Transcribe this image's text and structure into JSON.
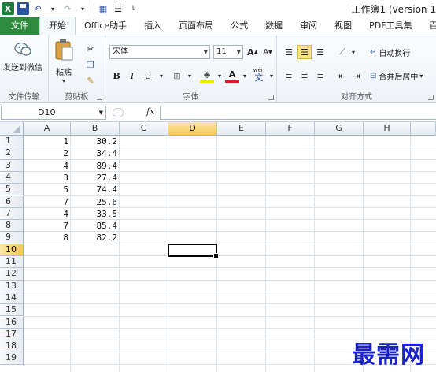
{
  "titlebar": {
    "title": "工作簿1 (version 1",
    "quick_access": [
      "excel-logo",
      "save-icon",
      "undo-icon",
      "redo-icon",
      "form-icon",
      "menu-icon"
    ],
    "logo_letter": "X"
  },
  "tabs": [
    "文件",
    "开始",
    "Office助手",
    "插入",
    "页面布局",
    "公式",
    "数据",
    "审阅",
    "视图",
    "PDF工具集",
    "百"
  ],
  "ribbon": {
    "wechat": {
      "label": "发送到微信",
      "group": "文件传输"
    },
    "clipboard": {
      "paste": "粘贴",
      "group": "剪贴板"
    },
    "font": {
      "name": "宋体",
      "size": "11",
      "bold": "B",
      "italic": "I",
      "underline": "U",
      "grow": "A",
      "shrink": "A",
      "group": "字体",
      "phonetic": "wén"
    },
    "alignment": {
      "wrap": "自动换行",
      "merge": "合并后居中",
      "group": "对齐方式"
    }
  },
  "formula_bar": {
    "name_box": "D10",
    "fx": "fx",
    "value": ""
  },
  "grid": {
    "columns": [
      "A",
      "B",
      "C",
      "D",
      "E",
      "F",
      "G",
      "H"
    ],
    "rows": [
      "1",
      "2",
      "3",
      "4",
      "5",
      "6",
      "7",
      "8",
      "9",
      "10",
      "11",
      "12",
      "13",
      "14",
      "15",
      "16",
      "17",
      "18",
      "19"
    ],
    "selected_column": "D",
    "selected_row": "10",
    "data": [
      {
        "a": "1",
        "b": "30.2"
      },
      {
        "a": "2",
        "b": "34.4"
      },
      {
        "a": "4",
        "b": "89.4"
      },
      {
        "a": "3",
        "b": "27.4"
      },
      {
        "a": "5",
        "b": "74.4"
      },
      {
        "a": "7",
        "b": "25.6"
      },
      {
        "a": "4",
        "b": "33.5"
      },
      {
        "a": "7",
        "b": "85.4"
      },
      {
        "a": "8",
        "b": "82.2"
      }
    ]
  },
  "watermark": "最需网",
  "colors": {
    "file_tab": "#2e8b3e",
    "selection_header": "#f5c95a",
    "watermark": "#1a22c9"
  }
}
